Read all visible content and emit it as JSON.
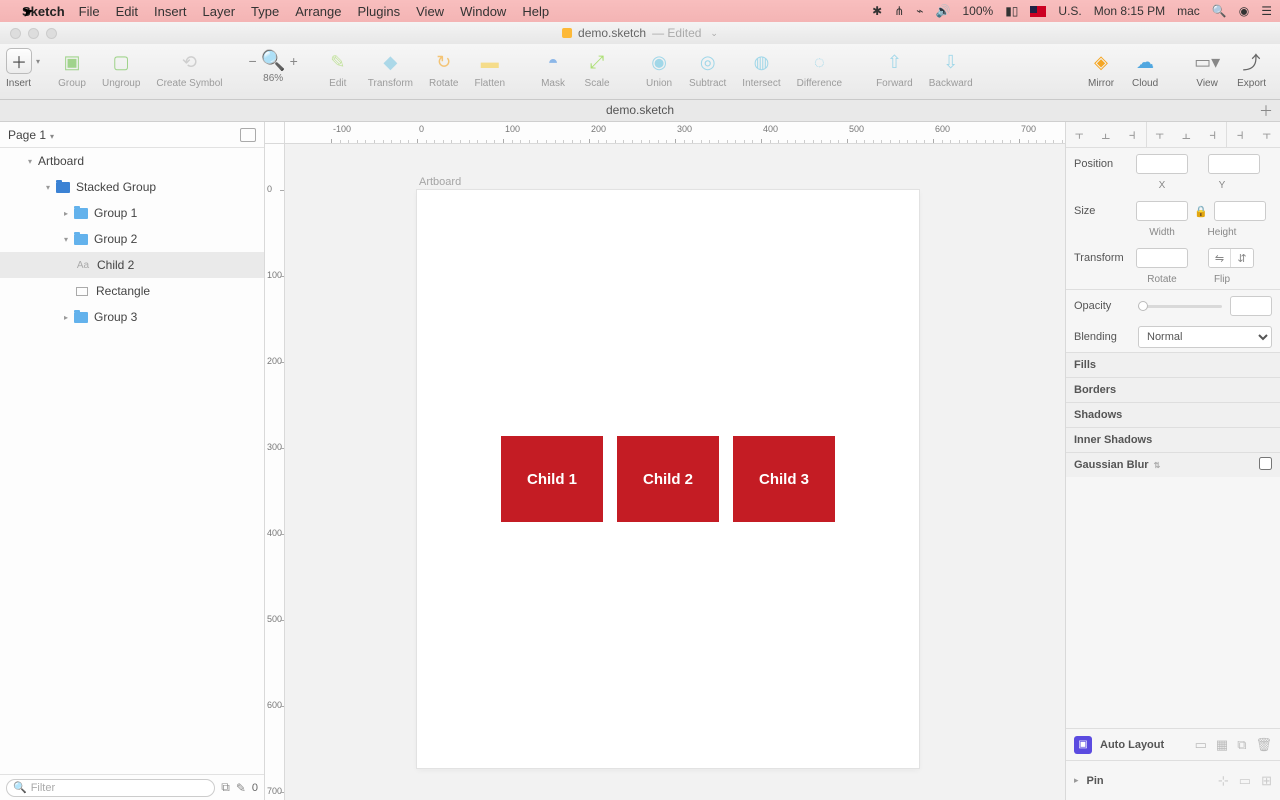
{
  "menubar": {
    "app": "Sketch",
    "items": [
      "File",
      "Edit",
      "Insert",
      "Layer",
      "Type",
      "Arrange",
      "Plugins",
      "View",
      "Window",
      "Help"
    ],
    "status": {
      "battery": "100%",
      "locale": "U.S.",
      "clock": "Mon 8:15 PM",
      "user": "mac"
    }
  },
  "window": {
    "doc": "demo.sketch",
    "state": "— Edited"
  },
  "toolbar": {
    "insert": "Insert",
    "group": "Group",
    "ungroup": "Ungroup",
    "createSymbol": "Create Symbol",
    "zoom": "86%",
    "edit": "Edit",
    "transform": "Transform",
    "rotate": "Rotate",
    "flatten": "Flatten",
    "mask": "Mask",
    "scale": "Scale",
    "union": "Union",
    "subtract": "Subtract",
    "intersect": "Intersect",
    "difference": "Difference",
    "forward": "Forward",
    "backward": "Backward",
    "mirror": "Mirror",
    "cloud": "Cloud",
    "view": "View",
    "export": "Export"
  },
  "tabs": {
    "active": "demo.sketch"
  },
  "sidebar": {
    "page": "Page 1",
    "filterPlaceholder": "Filter",
    "filterCount": "0",
    "layers": {
      "artboard": "Artboard",
      "stacked": "Stacked Group",
      "g1": "Group 1",
      "g2": "Group 2",
      "child2": "Child 2",
      "rect": "Rectangle",
      "g3": "Group 3"
    }
  },
  "canvas": {
    "artboardLabel": "Artboard",
    "rulerH": [
      "-100",
      "0",
      "100",
      "200",
      "300",
      "400",
      "500",
      "600",
      "700"
    ],
    "rulerV": [
      "0",
      "100",
      "200",
      "300",
      "400",
      "500",
      "600",
      "700"
    ],
    "children": [
      "Child 1",
      "Child 2",
      "Child 3"
    ]
  },
  "inspector": {
    "position": "Position",
    "x": "X",
    "y": "Y",
    "size": "Size",
    "width": "Width",
    "height": "Height",
    "transform": "Transform",
    "rotateLbl": "Rotate",
    "flipLbl": "Flip",
    "opacity": "Opacity",
    "blending": "Blending",
    "blendMode": "Normal",
    "fills": "Fills",
    "borders": "Borders",
    "shadows": "Shadows",
    "innerShadows": "Inner Shadows",
    "gauss": "Gaussian Blur",
    "autoLayout": "Auto Layout",
    "pin": "Pin"
  }
}
